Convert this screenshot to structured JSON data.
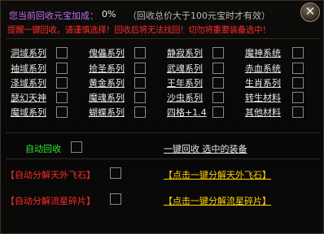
{
  "header": {
    "recycle_bonus_label": "您当前回收元宝加成：",
    "recycle_bonus_value": "0%",
    "recycle_note": "（回收总价大于100元宝时才有效）",
    "warning": "提醒一键回收，请谨慎选择！回收后将无法找回！切勿将重要装备选中！"
  },
  "categories": [
    [
      "洞域系列",
      "傀儡系列",
      "静寂系列",
      "魔神系统"
    ],
    [
      "袖域系列",
      "拾圣系列",
      "武魂系列",
      "赤血系统"
    ],
    [
      "泽域系列",
      "黄金系列",
      "王年系列",
      "生肖系列"
    ],
    [
      "瑟幻天神",
      "魔魂系列",
      "沙虫系列",
      "转生材料"
    ],
    [
      "魔域系列",
      "蝴蝶系列",
      "四格+1.4",
      "其他材料"
    ]
  ],
  "auto_recycle": {
    "label": "自动回收",
    "link": "一键回收  选中的装备"
  },
  "meteor": {
    "label": "【自动分解天外飞石】",
    "link": "【点击一键分解天外飞石】"
  },
  "star": {
    "label": "【自动分解流星碎片】",
    "link": "【点击一键分解流星碎片】"
  },
  "close_icon": "close-icon",
  "colors": {
    "purple": "#c070f0",
    "red": "#ff2a2a",
    "green": "#33e833",
    "yellow": "#ffd200"
  }
}
